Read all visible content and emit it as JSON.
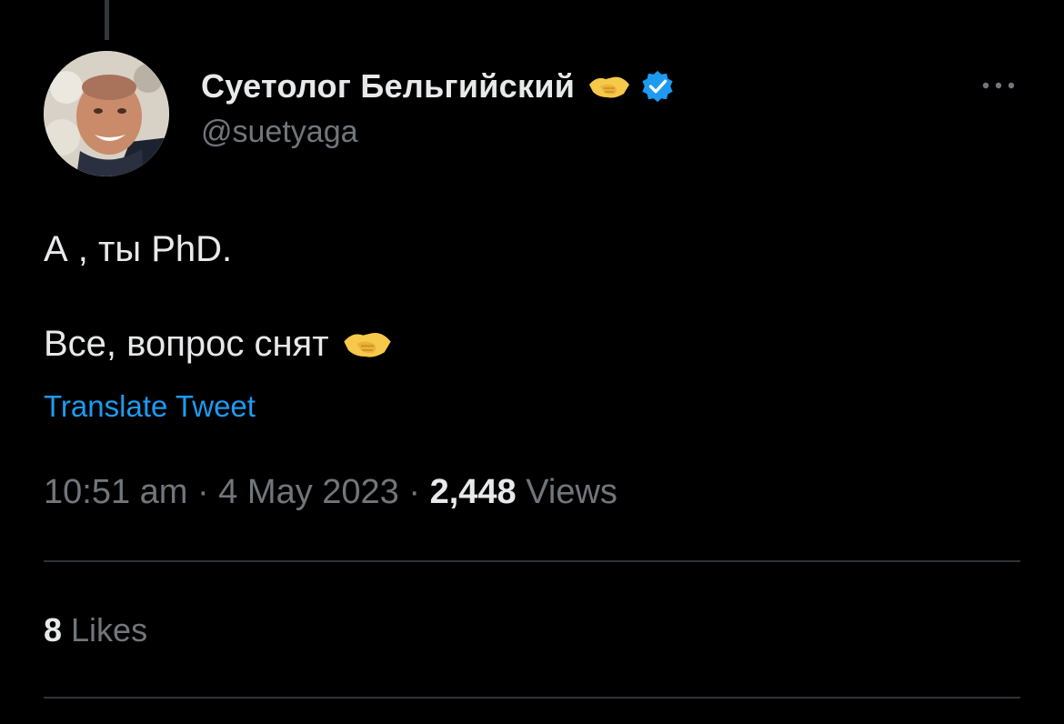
{
  "author": {
    "display_name": "Суетолог Бельгийский",
    "name_emoji": "handshake-emoji",
    "verified_icon": "verified-badge-icon",
    "verified_color": "#1d9bf0",
    "handle": "@suetyaga"
  },
  "tweet": {
    "line1": "А , ты PhD.",
    "line2": "Все, вопрос снят",
    "line2_emoji": "handshake-emoji",
    "translate_label": "Translate Tweet"
  },
  "meta": {
    "time": "10:51 am",
    "separator": " · ",
    "date": "4 May 2023",
    "views_count": "2,448",
    "views_label": " Views"
  },
  "stats": {
    "likes_count": "8",
    "likes_label": " Likes"
  },
  "colors": {
    "background": "#000000",
    "primary_text": "#e7e9ea",
    "secondary_text": "#71767b",
    "link": "#1d9bf0",
    "divider": "#2f3336"
  }
}
